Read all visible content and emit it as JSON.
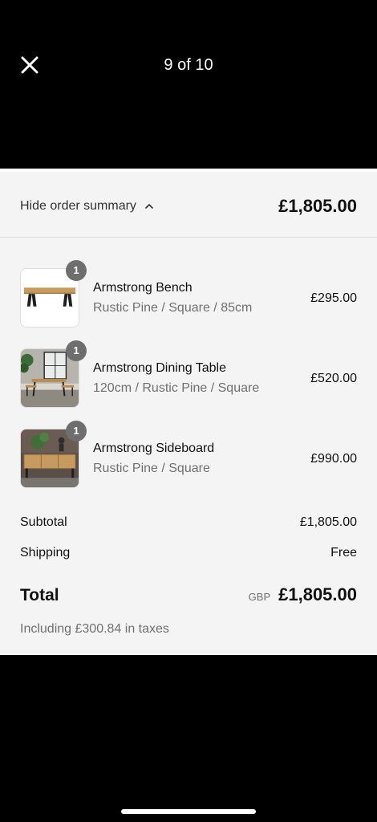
{
  "header": {
    "counter": "9 of 10",
    "close_icon": "close-icon"
  },
  "summary": {
    "toggle_label": "Hide order summary",
    "toggle_icon": "chevron-up-icon",
    "total": "£1,805.00"
  },
  "items": [
    {
      "name": "Armstrong Bench",
      "variant": "Rustic Pine / Square / 85cm",
      "price": "£295.00",
      "quantity": "1",
      "image": "bench-image"
    },
    {
      "name": "Armstrong Dining Table",
      "variant": "120cm / Rustic Pine / Square",
      "price": "£520.00",
      "quantity": "1",
      "image": "dining-table-image"
    },
    {
      "name": "Armstrong Sideboard",
      "variant": "Rustic Pine / Square",
      "price": "£990.00",
      "quantity": "1",
      "image": "sideboard-image"
    }
  ],
  "totals": {
    "subtotal_label": "Subtotal",
    "subtotal_value": "£1,805.00",
    "shipping_label": "Shipping",
    "shipping_value": "Free",
    "total_label": "Total",
    "currency": "GBP",
    "total_value": "£1,805.00",
    "taxes_note": "Including £300.84 in taxes"
  },
  "colors": {
    "background": "#000000",
    "sheet": "#f4f4f4",
    "badge": "#6e6e6e",
    "muted_text": "#707070"
  }
}
